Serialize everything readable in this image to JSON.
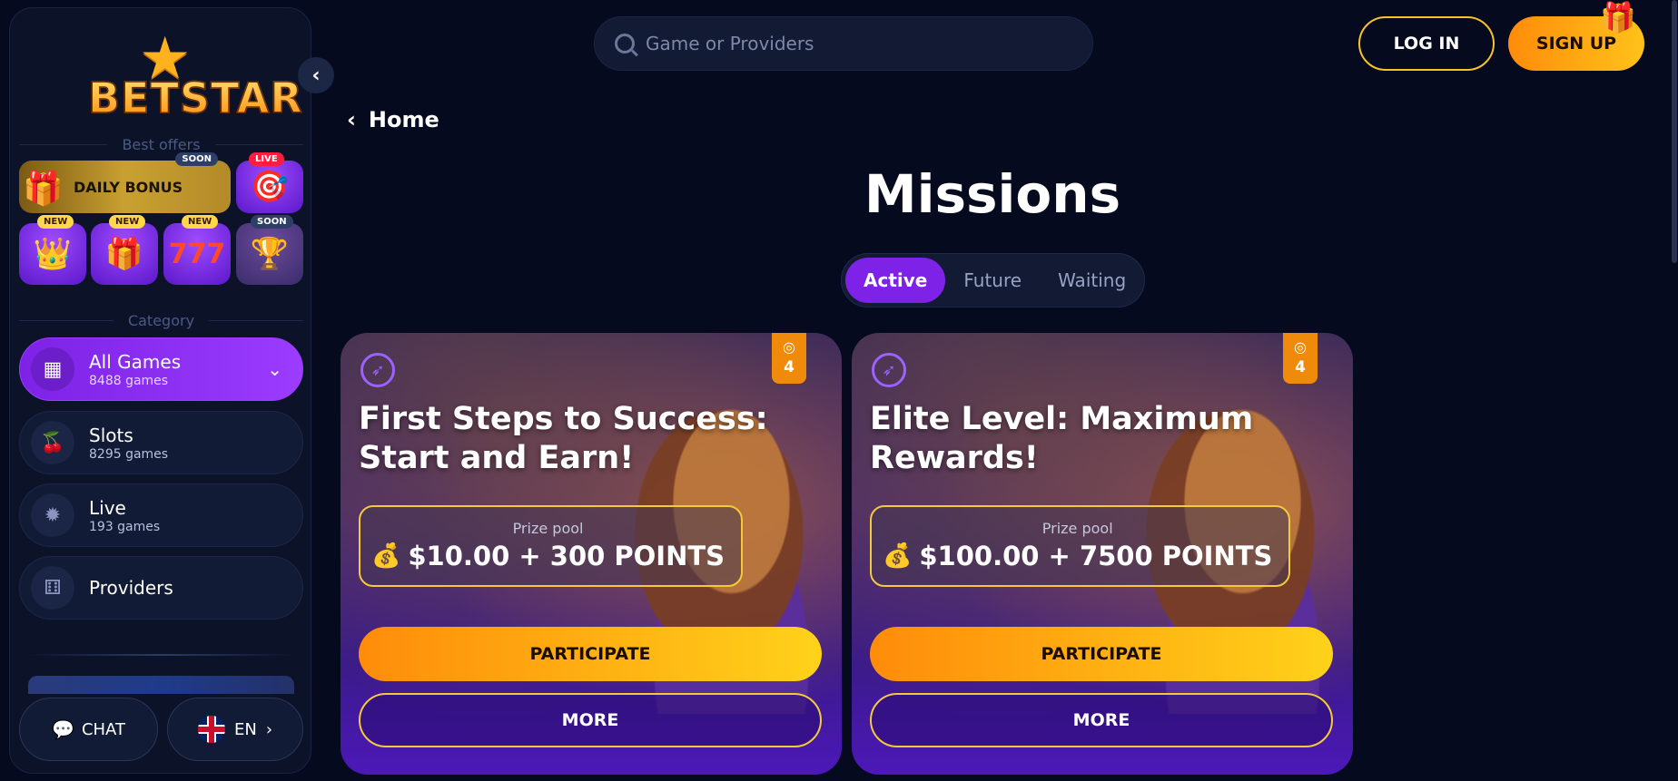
{
  "brand": {
    "logo_text": "BETSTAR"
  },
  "sidebar": {
    "collapse_icon": "‹",
    "best_offers_title": "Best offers",
    "offers": {
      "daily_bonus": {
        "label": "DAILY BONUS",
        "badge": "SOON"
      },
      "target": {
        "badge": "LIVE"
      },
      "crown": {
        "badge": "NEW"
      },
      "gift": {
        "badge": "NEW"
      },
      "slots777": {
        "badge": "NEW"
      },
      "trophy": {
        "badge": "SOON"
      }
    },
    "category_title": "Category",
    "categories": [
      {
        "name": "All Games",
        "count": "8488 games"
      },
      {
        "name": "Slots",
        "count": "8295 games"
      },
      {
        "name": "Live",
        "count": "193 games"
      },
      {
        "name": "Providers"
      }
    ],
    "chat_label": "CHAT",
    "lang_label": "EN"
  },
  "header": {
    "search_placeholder": "Game or Providers",
    "login_label": "LOG IN",
    "signup_label": "SIGN UP"
  },
  "main": {
    "breadcrumb": "Home",
    "title": "Missions",
    "tabs": [
      "Active",
      "Future",
      "Waiting"
    ],
    "cards": [
      {
        "title": "First Steps to Success: Start and Earn!",
        "level": "4",
        "prize_label": "Prize pool",
        "prize_value": "$10.00 + 300 POINTS",
        "participate_label": "PARTICIPATE",
        "more_label": "MORE"
      },
      {
        "title": "Elite Level: Maximum Rewards!",
        "level": "4",
        "prize_label": "Prize pool",
        "prize_value": "$100.00 + 7500 POINTS",
        "participate_label": "PARTICIPATE",
        "more_label": "MORE"
      }
    ]
  },
  "colors": {
    "accent_purple": "#7d22e6",
    "accent_orange": "#ff8c0a",
    "accent_gold": "#f4c93b",
    "background": "#050a1f"
  }
}
